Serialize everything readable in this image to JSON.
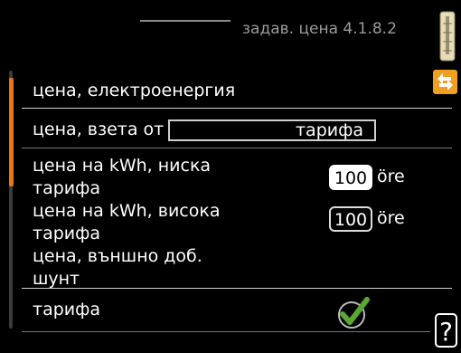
{
  "header": {
    "menu_code": "задав. цена 4.1.8.2"
  },
  "rows": {
    "section_title": "цена, електроенергия",
    "price_from": {
      "label": "цена, взета от",
      "value": "тарифа"
    },
    "low_tariff": {
      "label_line1": "цена на kWh, ниска",
      "label_line2": "тарифа",
      "value": "100",
      "unit": "öre"
    },
    "high_tariff": {
      "label_line1": "цена на kWh, висока",
      "label_line2": "тарифа",
      "value": "100",
      "unit": "öre"
    },
    "external_shunt": {
      "label_line1": "цена, външно доб.",
      "label_line2": "шунт"
    },
    "tariff_check": {
      "label": "тарифа",
      "checked": true
    }
  },
  "icons": {
    "thermometer": "thermometer-icon",
    "arrows": "sort-arrows-icon",
    "check": "check-icon",
    "help": "help-icon"
  },
  "colors": {
    "accent": "#e8751e",
    "check": "#5aa832",
    "background": "#000000",
    "text": "#ffffff"
  }
}
